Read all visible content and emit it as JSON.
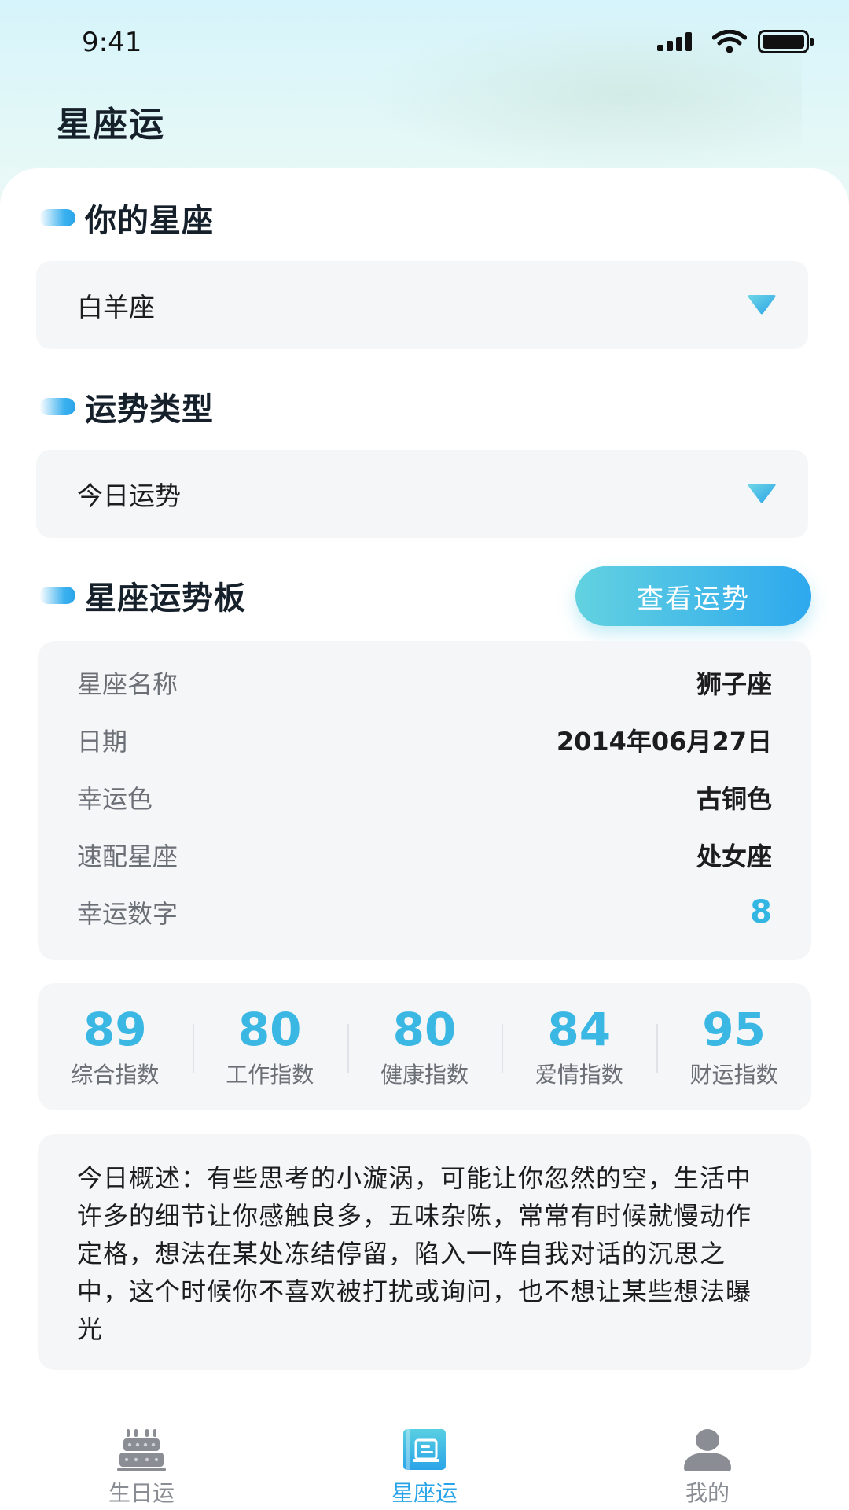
{
  "status_bar": {
    "time": "9:41"
  },
  "header": {
    "title": "星座运"
  },
  "sections": {
    "constellation": {
      "title": "你的星座",
      "selected": "白羊座"
    },
    "fortune_type": {
      "title": "运势类型",
      "selected": "今日运势"
    },
    "board": {
      "title": "星座运势板",
      "view_button": "查看运势"
    }
  },
  "info": {
    "rows": [
      {
        "label": "星座名称",
        "value": "狮子座"
      },
      {
        "label": "日期",
        "value": "2014年06月27日"
      },
      {
        "label": "幸运色",
        "value": "古铜色"
      },
      {
        "label": "速配星座",
        "value": "处女座"
      },
      {
        "label": "幸运数字",
        "value": "8"
      }
    ]
  },
  "indices": [
    {
      "value": "89",
      "label": "综合指数"
    },
    {
      "value": "80",
      "label": "工作指数"
    },
    {
      "value": "80",
      "label": "健康指数"
    },
    {
      "value": "84",
      "label": "爱情指数"
    },
    {
      "value": "95",
      "label": "财运指数"
    }
  ],
  "summary": {
    "text": "今日概述：有些思考的小漩涡，可能让你忽然的空，生活中许多的细节让你感触良多，五味杂陈，常常有时候就慢动作定格，想法在某处冻结停留，陷入一阵自我对话的沉思之中，这个时候你不喜欢被打扰或询问，也不想让某些想法曝光"
  },
  "tabbar": {
    "items": [
      {
        "label": "生日运",
        "icon": "cake-icon",
        "active": false
      },
      {
        "label": "星座运",
        "icon": "book-icon",
        "active": true
      },
      {
        "label": "我的",
        "icon": "user-icon",
        "active": false
      }
    ]
  },
  "colors": {
    "accent": "#2aa4e8",
    "accent_light": "#62d2e0",
    "index_number": "#3bb7e4",
    "panel_bg": "#f5f6f8",
    "tab_inactive": "#8a8e94"
  }
}
